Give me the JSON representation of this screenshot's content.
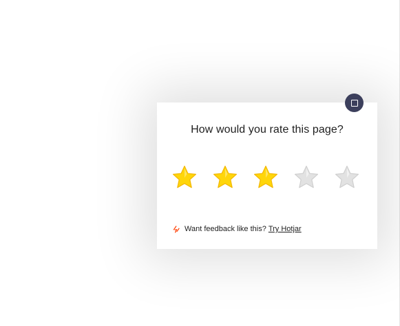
{
  "survey": {
    "question": "How would you rate this page?",
    "rating": {
      "value": 3,
      "max": 5
    },
    "stars": [
      {
        "index": 1,
        "filled": true
      },
      {
        "index": 2,
        "filled": true
      },
      {
        "index": 3,
        "filled": true
      },
      {
        "index": 4,
        "filled": false
      },
      {
        "index": 5,
        "filled": false
      }
    ],
    "colors": {
      "star_filled": "#FFD60A",
      "star_filled_dark": "#F2B705",
      "star_empty": "#E2E2E2",
      "star_empty_dark": "#CFCFCF",
      "close_button": "#3C3F5C",
      "brand": "#FF3C00"
    },
    "minimize_icon": "square-icon",
    "footer": {
      "text": "Want feedback like this?",
      "link_label": "Try Hotjar",
      "logo_icon": "hotjar-logo-icon"
    }
  }
}
